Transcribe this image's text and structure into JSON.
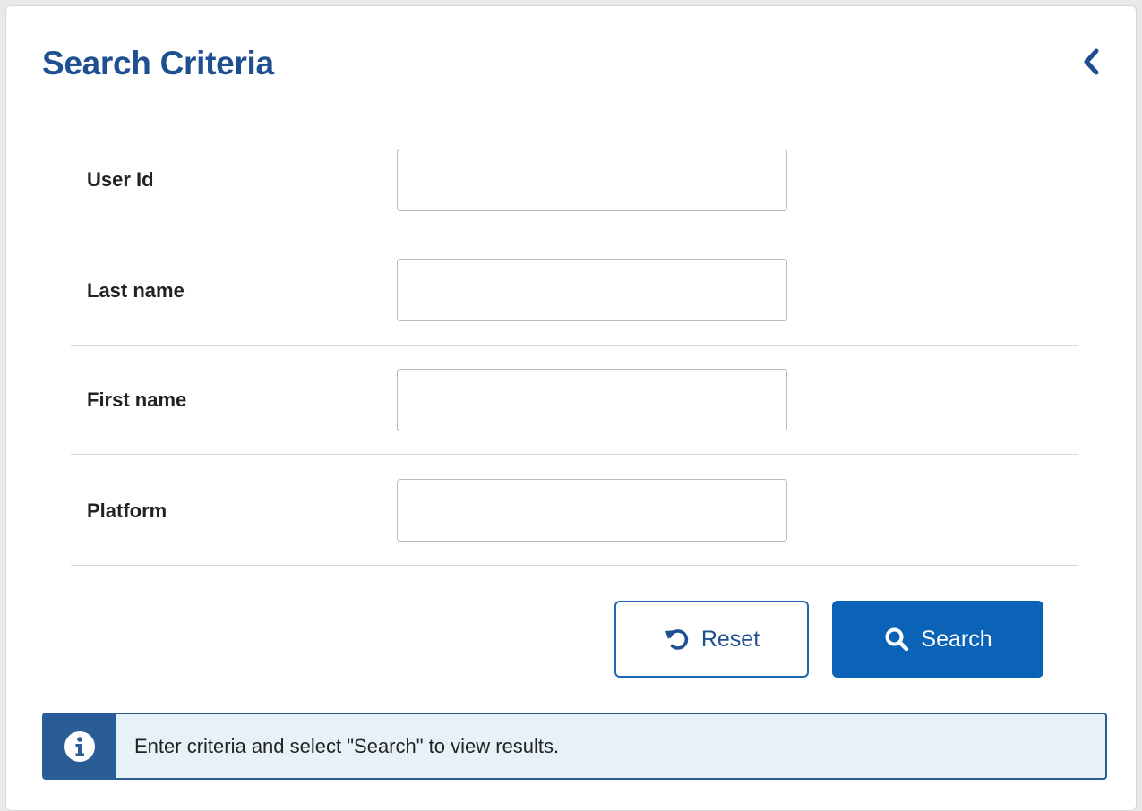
{
  "header": {
    "title": "Search Criteria",
    "collapse_icon": "chevron-left-icon"
  },
  "form": {
    "fields": [
      {
        "label": "User Id",
        "value": "",
        "placeholder": ""
      },
      {
        "label": "Last name",
        "value": "",
        "placeholder": ""
      },
      {
        "label": "First name",
        "value": "",
        "placeholder": ""
      },
      {
        "label": "Platform",
        "value": "",
        "placeholder": ""
      }
    ]
  },
  "actions": {
    "reset_label": "Reset",
    "reset_icon": "undo-icon",
    "search_label": "Search",
    "search_icon": "search-icon"
  },
  "info": {
    "icon": "info-icon",
    "message": "Enter criteria and select \"Search\" to view results."
  },
  "colors": {
    "title": "#1d4f91",
    "primary_button": "#0b63b7",
    "info_border": "#2a5d97",
    "info_background": "#e6f1f8"
  }
}
